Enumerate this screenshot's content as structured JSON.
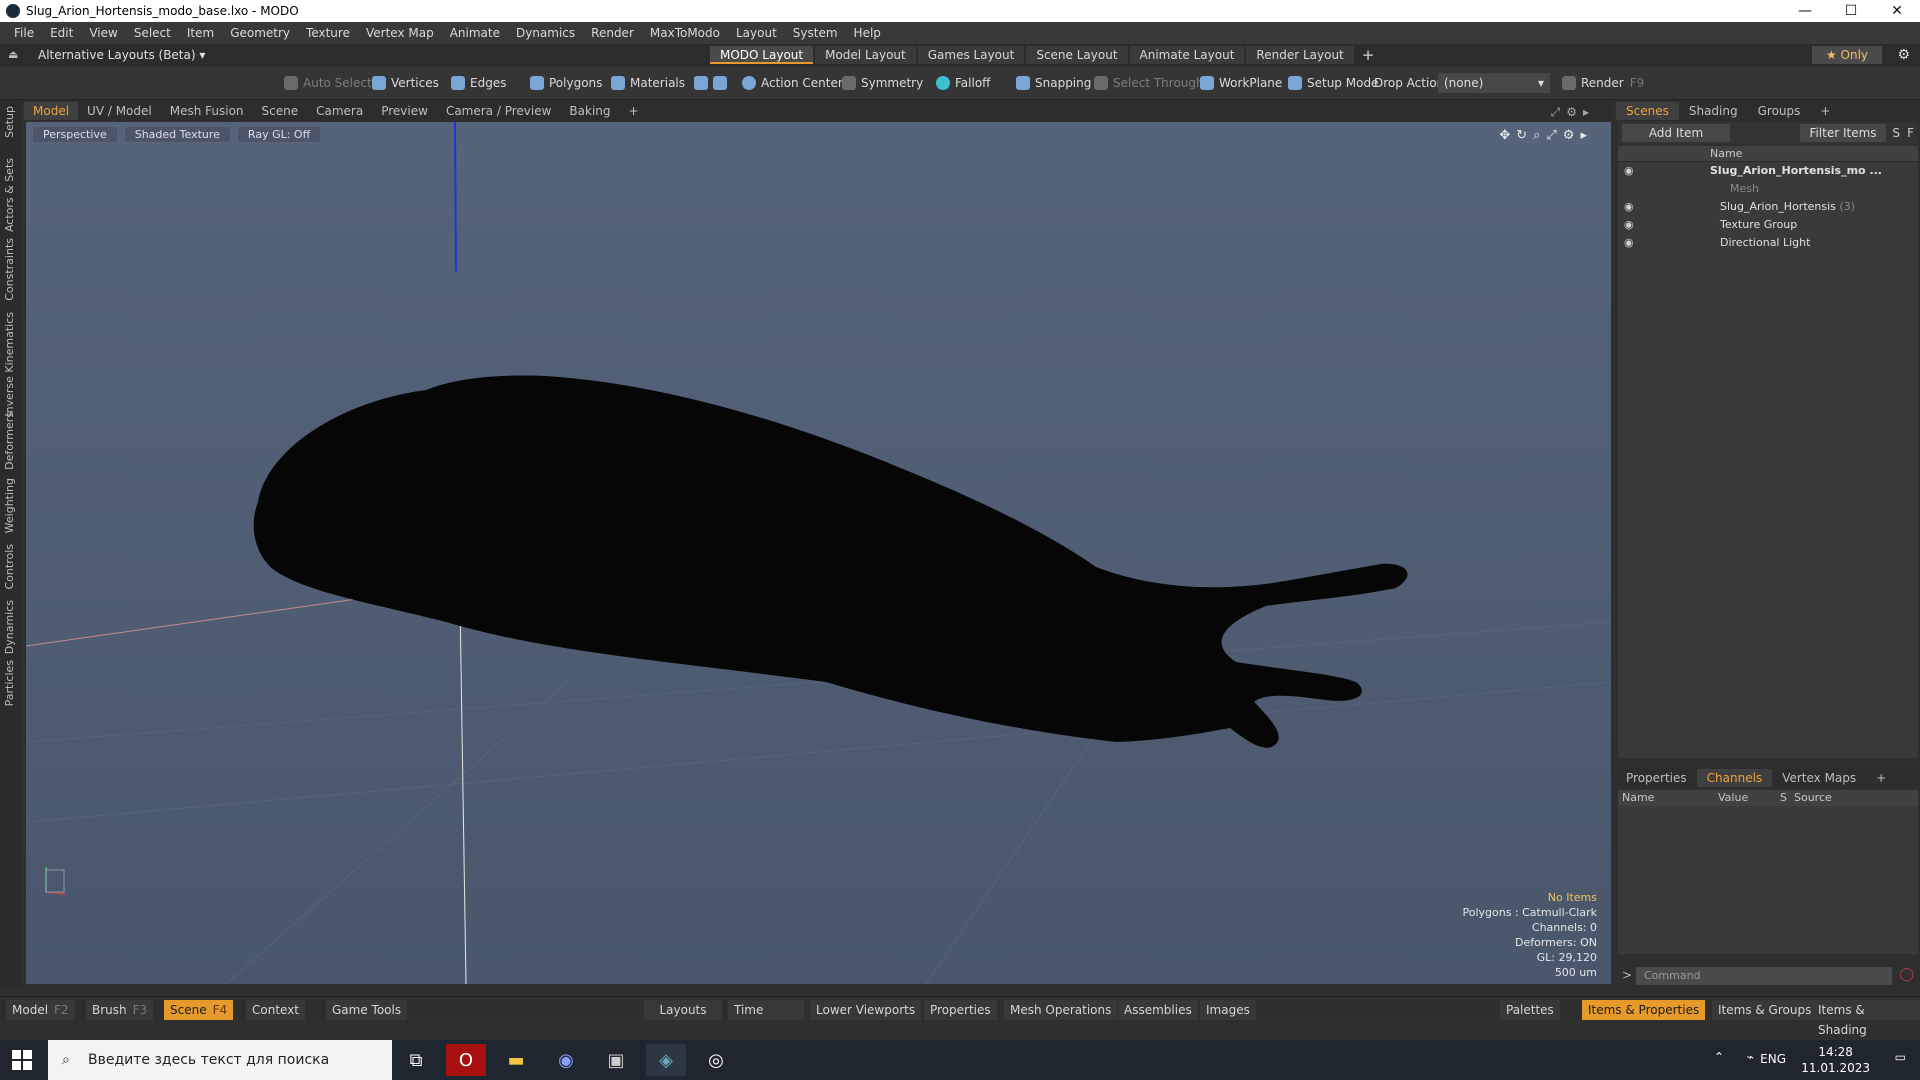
{
  "window": {
    "title": "Slug_Arion_Hortensis_modo_base.lxo - MODO",
    "controls": [
      "—",
      "☐",
      "✕"
    ]
  },
  "menu": [
    "File",
    "Edit",
    "View",
    "Select",
    "Item",
    "Geometry",
    "Texture",
    "Vertex Map",
    "Animate",
    "Dynamics",
    "Render",
    "MaxToModo",
    "Layout",
    "System",
    "Help"
  ],
  "layout_row": {
    "alt_layouts": "Alternative Layouts (Beta) ▾",
    "tabs": [
      "MODO Layout",
      "Model Layout",
      "Games Layout",
      "Scene Layout",
      "Animate Layout",
      "Render Layout"
    ],
    "active_tab": "MODO Layout",
    "only_label": "★  Only"
  },
  "toolbar": {
    "auto_select": "Auto Select",
    "vertices": "Vertices",
    "edges": "Edges",
    "polygons": "Polygons",
    "materials": "Materials",
    "action_center": "Action Center",
    "symmetry": "Symmetry",
    "falloff": "Falloff",
    "snapping": "Snapping",
    "select_through": "Select Through",
    "workplane": "WorkPlane",
    "setup_mode": "Setup Mode",
    "drop_action": "Drop Action",
    "drop_value": "(none)",
    "render": "Render",
    "render_key": "F9"
  },
  "left_tabs": [
    "Setup",
    "Actors & Sets",
    "Constraints",
    "Inverse Kinematics",
    "Deformers",
    "Weighting",
    "Controls",
    "Dynamics",
    "Particles"
  ],
  "viewport_tabs": [
    "Model",
    "UV / Model",
    "Mesh Fusion",
    "Scene",
    "Camera",
    "Preview",
    "Camera / Preview",
    "Baking",
    "+"
  ],
  "viewport": {
    "buttons": [
      "Perspective",
      "Shaded Texture",
      "Ray GL: Off"
    ],
    "stats": {
      "no_items": "No Items",
      "polygons": "Polygons : Catmull-Clark",
      "channels": "Channels: 0",
      "deformers": "Deformers: ON",
      "gl": "GL: 29,120",
      "scale": "500 um"
    }
  },
  "scenes": {
    "tabs": [
      "Scenes",
      "Shading",
      "Groups",
      "+"
    ],
    "add_item": "Add Item",
    "filter_items": "Filter Items",
    "s_btn": "S",
    "f_btn": "F",
    "column_name": "Name",
    "tree": [
      {
        "label": "Slug_Arion_Hortensis_mo ...",
        "bold": true
      },
      {
        "label": "Mesh",
        "dim": true
      },
      {
        "label": "Slug_Arion_Hortensis",
        "count": "(3)"
      },
      {
        "label": "Texture Group"
      },
      {
        "label": "Directional Light"
      }
    ]
  },
  "properties": {
    "tabs": [
      "Properties",
      "Channels",
      "Vertex Maps",
      "+"
    ],
    "columns": [
      "Name",
      "Value",
      "S",
      "Source"
    ]
  },
  "command": {
    "placeholder": "Command"
  },
  "dock": {
    "model": "Model",
    "model_key": "F2",
    "brush": "Brush",
    "brush_key": "F3",
    "scene": "Scene",
    "scene_key": "F4",
    "context": "Context",
    "game_tools": "Game Tools",
    "layouts": "Layouts",
    "time": "Time",
    "lower_viewports": "Lower Viewports",
    "properties": "Properties",
    "mesh_operations": "Mesh Operations",
    "assemblies": "Assemblies",
    "images": "Images",
    "palettes": "Palettes",
    "items_properties": "Items & Properties",
    "items_groups": "Items & Groups",
    "items_shading": "Items & Shading"
  },
  "taskbar": {
    "search_placeholder": "Введите здесь текст для поиска",
    "lang": "ENG",
    "time": "14:28",
    "date": "11.01.2023"
  },
  "colors": {
    "accent": "#e59a2b",
    "viewport_bg": "#56647a"
  }
}
